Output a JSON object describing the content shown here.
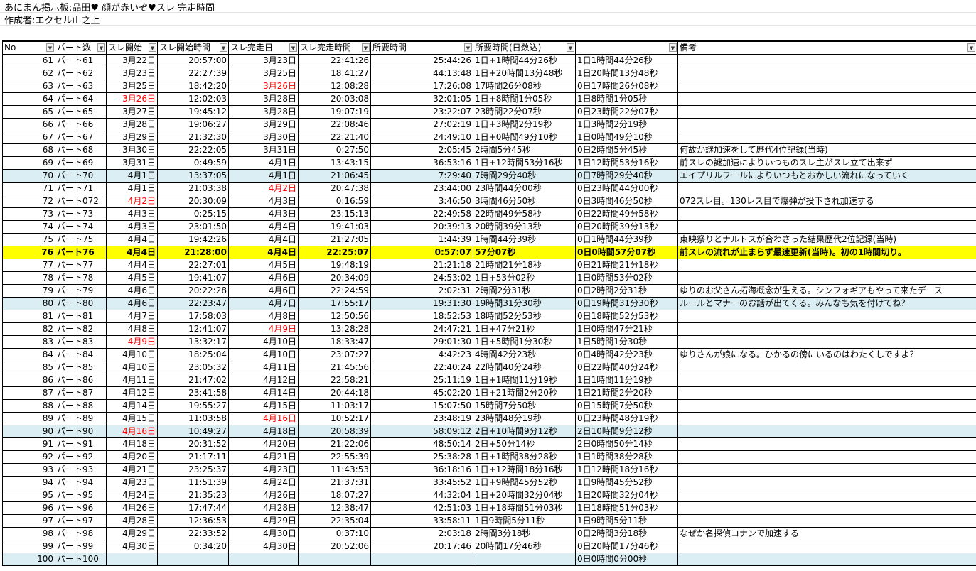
{
  "sheet": {
    "title": "あにまん掲示板:品田♥ 顔が赤いぞ♥スレ 完走時間",
    "author": "作成者:エクセル山之上"
  },
  "columns": [
    "No",
    "パート数",
    "スレ開始",
    "スレ開始時間",
    "スレ完走日",
    "スレ完走時間",
    "所要時間",
    "所要時間(日数込)",
    "",
    "備考"
  ],
  "rows": [
    {
      "no": "61",
      "part": "パート61",
      "start_date": "3月22日",
      "start_time": "20:57:00",
      "end_date": "3月23日",
      "end_time": "22:41:26",
      "dur": "25:44:26",
      "dur_days": "1日+1時間44分26秒",
      "dur_fmt": "1日1時間44分26秒",
      "note": ""
    },
    {
      "no": "62",
      "part": "パート62",
      "start_date": "3月23日",
      "start_time": "22:27:39",
      "end_date": "3月25日",
      "end_time": "18:41:27",
      "dur": "44:13:48",
      "dur_days": "1日+20時間13分48秒",
      "dur_fmt": "1日20時間13分48秒",
      "note": ""
    },
    {
      "no": "63",
      "part": "パート63",
      "start_date": "3月25日",
      "start_time": "18:42:20",
      "end_date": "3月26日",
      "end_time": "12:08:28",
      "dur": "17:26:08",
      "dur_days": "17時間26分08秒",
      "dur_fmt": "0日17時間26分08秒",
      "note": "",
      "end_red": true
    },
    {
      "no": "64",
      "part": "パート64",
      "start_date": "3月26日",
      "start_time": "12:02:03",
      "end_date": "3月28日",
      "end_time": "20:03:08",
      "dur": "32:01:05",
      "dur_days": "1日+8時間1分05秒",
      "dur_fmt": "1日8時間1分05秒",
      "note": "",
      "start_red": true
    },
    {
      "no": "65",
      "part": "パート65",
      "start_date": "3月27日",
      "start_time": "19:45:12",
      "end_date": "3月28日",
      "end_time": "19:07:19",
      "dur": "23:22:07",
      "dur_days": "23時間22分07秒",
      "dur_fmt": "0日23時間22分07秒",
      "note": ""
    },
    {
      "no": "66",
      "part": "パート66",
      "start_date": "3月28日",
      "start_time": "19:06:27",
      "end_date": "3月29日",
      "end_time": "22:08:46",
      "dur": "27:02:19",
      "dur_days": "1日+3時間2分19秒",
      "dur_fmt": "1日3時間2分19秒",
      "note": ""
    },
    {
      "no": "67",
      "part": "パート67",
      "start_date": "3月29日",
      "start_time": "21:32:30",
      "end_date": "3月30日",
      "end_time": "22:21:40",
      "dur": "24:49:10",
      "dur_days": "1日+0時間49分10秒",
      "dur_fmt": "1日0時間49分10秒",
      "note": ""
    },
    {
      "no": "68",
      "part": "パート68",
      "start_date": "3月30日",
      "start_time": "22:22:05",
      "end_date": "3月31日",
      "end_time": "0:27:50",
      "dur": "2:05:45",
      "dur_days": "2時間5分45秒",
      "dur_fmt": "0日2時間5分45秒",
      "note": "何故か謎加速をして歴代4位記録(当時)"
    },
    {
      "no": "69",
      "part": "パート69",
      "start_date": "3月31日",
      "start_time": "0:49:59",
      "end_date": "4月1日",
      "end_time": "13:43:15",
      "dur": "36:53:16",
      "dur_days": "1日+12時間53分16秒",
      "dur_fmt": "1日12時間53分16秒",
      "note": "前スレの謎加速によりいつものスレ主がスレ立て出来ず"
    },
    {
      "no": "70",
      "part": "パート70",
      "start_date": "4月1日",
      "start_time": "13:37:05",
      "end_date": "4月1日",
      "end_time": "21:06:45",
      "dur": "7:29:40",
      "dur_days": "7時間29分40秒",
      "dur_fmt": "0日7時間29分40秒",
      "note": "エイプリルフールによりいつもとおかしい流れになっていく",
      "hl": "blue"
    },
    {
      "no": "71",
      "part": "パート71",
      "start_date": "4月1日",
      "start_time": "21:03:38",
      "end_date": "4月2日",
      "end_time": "20:47:38",
      "dur": "23:44:00",
      "dur_days": "23時間44分00秒",
      "dur_fmt": "0日23時間44分00秒",
      "note": "",
      "end_red": true
    },
    {
      "no": "72",
      "part": "パート072",
      "start_date": "4月2日",
      "start_time": "20:30:09",
      "end_date": "4月3日",
      "end_time": "0:16:59",
      "dur": "3:46:50",
      "dur_days": "3時間46分50秒",
      "dur_fmt": "0日3時間46分50秒",
      "note": "072スレ目。130レス目で爆弾が投下され加速する",
      "start_red": true
    },
    {
      "no": "73",
      "part": "パート73",
      "start_date": "4月3日",
      "start_time": "0:25:15",
      "end_date": "4月3日",
      "end_time": "23:15:13",
      "dur": "22:49:58",
      "dur_days": "22時間49分58秒",
      "dur_fmt": "0日22時間49分58秒",
      "note": ""
    },
    {
      "no": "74",
      "part": "パート74",
      "start_date": "4月3日",
      "start_time": "23:01:50",
      "end_date": "4月4日",
      "end_time": "19:41:03",
      "dur": "20:39:13",
      "dur_days": "20時間39分13秒",
      "dur_fmt": "0日20時間39分13秒",
      "note": ""
    },
    {
      "no": "75",
      "part": "パート75",
      "start_date": "4月4日",
      "start_time": "19:42:26",
      "end_date": "4月4日",
      "end_time": "21:27:05",
      "dur": "1:44:39",
      "dur_days": "1時間44分39秒",
      "dur_fmt": "0日1時間44分39秒",
      "note": "東映祭りとナルトスが合わさった結果歴代2位記録(当時)"
    },
    {
      "no": "76",
      "part": "パート76",
      "start_date": "4月4日",
      "start_time": "21:28:00",
      "end_date": "4月4日",
      "end_time": "22:25:07",
      "dur": "0:57:07",
      "dur_days": "57分07秒",
      "dur_fmt": "0日0時間57分07秒",
      "note": "前スレの流れが止まらず最速更新(当時)。初の1時間切り。",
      "hl": "yellow"
    },
    {
      "no": "77",
      "part": "パート77",
      "start_date": "4月4日",
      "start_time": "22:27:01",
      "end_date": "4月5日",
      "end_time": "19:48:19",
      "dur": "21:21:18",
      "dur_days": "21時間21分18秒",
      "dur_fmt": "0日21時間21分18秒",
      "note": ""
    },
    {
      "no": "78",
      "part": "パート78",
      "start_date": "4月5日",
      "start_time": "19:41:07",
      "end_date": "4月6日",
      "end_time": "20:34:09",
      "dur": "24:53:02",
      "dur_days": "1日+53分02秒",
      "dur_fmt": "1日0時間53分02秒",
      "note": ""
    },
    {
      "no": "79",
      "part": "パート79",
      "start_date": "4月6日",
      "start_time": "20:22:28",
      "end_date": "4月6日",
      "end_time": "22:24:59",
      "dur": "2:02:31",
      "dur_days": "2時間2分31秒",
      "dur_fmt": "0日2時間2分31秒",
      "note": "ゆりのお父さん拓海概念が生える。シンフォギアもやって来たデース"
    },
    {
      "no": "80",
      "part": "パート80",
      "start_date": "4月6日",
      "start_time": "22:23:47",
      "end_date": "4月7日",
      "end_time": "17:55:17",
      "dur": "19:31:30",
      "dur_days": "19時間31分30秒",
      "dur_fmt": "0日19時間31分30秒",
      "note": "ルールとマナーのお話が出てくる。みんなも気を付けてね？",
      "hl": "blue"
    },
    {
      "no": "81",
      "part": "パート81",
      "start_date": "4月7日",
      "start_time": "17:58:03",
      "end_date": "4月8日",
      "end_time": "12:50:56",
      "dur": "18:52:53",
      "dur_days": "18時間52分53秒",
      "dur_fmt": "0日18時間52分53秒",
      "note": ""
    },
    {
      "no": "82",
      "part": "パート82",
      "start_date": "4月8日",
      "start_time": "12:41:07",
      "end_date": "4月9日",
      "end_time": "13:28:28",
      "dur": "24:47:21",
      "dur_days": "1日+47分21秒",
      "dur_fmt": "1日0時間47分21秒",
      "note": "",
      "end_red": true
    },
    {
      "no": "83",
      "part": "パート83",
      "start_date": "4月9日",
      "start_time": "13:32:17",
      "end_date": "4月10日",
      "end_time": "18:33:47",
      "dur": "29:01:30",
      "dur_days": "1日+5時間1分30秒",
      "dur_fmt": "1日5時間1分30秒",
      "note": "",
      "start_red": true
    },
    {
      "no": "84",
      "part": "パート84",
      "start_date": "4月10日",
      "start_time": "18:25:04",
      "end_date": "4月10日",
      "end_time": "23:07:27",
      "dur": "4:42:23",
      "dur_days": "4時間42分23秒",
      "dur_fmt": "0日4時間42分23秒",
      "note": "ゆりさんが娘になる。ひかるの傍にいるのはわたくしですよ？"
    },
    {
      "no": "85",
      "part": "パート85",
      "start_date": "4月10日",
      "start_time": "23:05:32",
      "end_date": "4月11日",
      "end_time": "21:45:56",
      "dur": "22:40:24",
      "dur_days": "22時間40分24秒",
      "dur_fmt": "0日22時間40分24秒",
      "note": ""
    },
    {
      "no": "86",
      "part": "パート86",
      "start_date": "4月11日",
      "start_time": "21:47:02",
      "end_date": "4月12日",
      "end_time": "22:58:21",
      "dur": "25:11:19",
      "dur_days": "1日+1時間11分19秒",
      "dur_fmt": "1日1時間11分19秒",
      "note": ""
    },
    {
      "no": "87",
      "part": "パート87",
      "start_date": "4月12日",
      "start_time": "23:41:58",
      "end_date": "4月14日",
      "end_time": "20:44:18",
      "dur": "45:02:20",
      "dur_days": "1日+21時間2分20秒",
      "dur_fmt": "1日21時間2分20秒",
      "note": ""
    },
    {
      "no": "88",
      "part": "パート88",
      "start_date": "4月14日",
      "start_time": "19:55:27",
      "end_date": "4月15日",
      "end_time": "11:03:17",
      "dur": "15:07:50",
      "dur_days": "15時間7分50秒",
      "dur_fmt": "0日15時間7分50秒",
      "note": ""
    },
    {
      "no": "89",
      "part": "パート89",
      "start_date": "4月15日",
      "start_time": "11:03:58",
      "end_date": "4月16日",
      "end_time": "10:52:17",
      "dur": "23:48:19",
      "dur_days": "23時間48分19秒",
      "dur_fmt": "0日23時間48分19秒",
      "note": "",
      "end_red": true
    },
    {
      "no": "90",
      "part": "パート90",
      "start_date": "4月16日",
      "start_time": "10:49:27",
      "end_date": "4月18日",
      "end_time": "20:58:39",
      "dur": "58:09:12",
      "dur_days": "2日+10時間9分12秒",
      "dur_fmt": "2日10時間9分12秒",
      "note": "",
      "hl": "blue",
      "start_red": true
    },
    {
      "no": "91",
      "part": "パート91",
      "start_date": "4月18日",
      "start_time": "20:31:52",
      "end_date": "4月20日",
      "end_time": "21:22:06",
      "dur": "48:50:14",
      "dur_days": "2日+50分14秒",
      "dur_fmt": "2日0時間50分14秒",
      "note": ""
    },
    {
      "no": "92",
      "part": "パート92",
      "start_date": "4月20日",
      "start_time": "21:17:11",
      "end_date": "4月21日",
      "end_time": "22:55:39",
      "dur": "25:38:28",
      "dur_days": "1日+1時間38分28秒",
      "dur_fmt": "1日1時間38分28秒",
      "note": ""
    },
    {
      "no": "93",
      "part": "パート93",
      "start_date": "4月21日",
      "start_time": "23:25:37",
      "end_date": "4月23日",
      "end_time": "11:43:53",
      "dur": "36:18:16",
      "dur_days": "1日+12時間18分16秒",
      "dur_fmt": "1日12時間18分16秒",
      "note": ""
    },
    {
      "no": "94",
      "part": "パート94",
      "start_date": "4月23日",
      "start_time": "11:51:39",
      "end_date": "4月24日",
      "end_time": "21:37:31",
      "dur": "33:45:52",
      "dur_days": "1日+9時間45分52秒",
      "dur_fmt": "1日9時間45分52秒",
      "note": ""
    },
    {
      "no": "95",
      "part": "パート95",
      "start_date": "4月24日",
      "start_time": "21:35:23",
      "end_date": "4月26日",
      "end_time": "18:07:27",
      "dur": "44:32:04",
      "dur_days": "1日+20時間32分04秒",
      "dur_fmt": "1日20時間32分04秒",
      "note": ""
    },
    {
      "no": "96",
      "part": "パート96",
      "start_date": "4月26日",
      "start_time": "17:47:44",
      "end_date": "4月28日",
      "end_time": "12:38:47",
      "dur": "42:51:03",
      "dur_days": "1日+18時間51分03秒",
      "dur_fmt": "1日18時間51分03秒",
      "note": ""
    },
    {
      "no": "97",
      "part": "パート97",
      "start_date": "4月28日",
      "start_time": "12:36:53",
      "end_date": "4月29日",
      "end_time": "22:35:04",
      "dur": "33:58:11",
      "dur_days": "1日9時間5分11秒",
      "dur_fmt": "1日9時間5分11秒",
      "note": ""
    },
    {
      "no": "98",
      "part": "パート98",
      "start_date": "4月29日",
      "start_time": "22:33:52",
      "end_date": "4月30日",
      "end_time": "0:37:10",
      "dur": "2:03:18",
      "dur_days": "2時間3分18秒",
      "dur_fmt": "0日2時間3分18秒",
      "note": "なぜか名探偵コナンで加速する"
    },
    {
      "no": "99",
      "part": "パート99",
      "start_date": "4月30日",
      "start_time": "0:34:20",
      "end_date": "4月30日",
      "end_time": "20:52:06",
      "dur": "20:17:46",
      "dur_days": "20時間17分46秒",
      "dur_fmt": "0日20時間17分46秒",
      "note": ""
    },
    {
      "no": "100",
      "part": "パート100",
      "start_date": "",
      "start_time": "",
      "end_date": "",
      "end_time": "",
      "dur": "",
      "dur_days": "",
      "dur_fmt": "0日0時間0分00秒",
      "note": "",
      "hl": "blue"
    }
  ]
}
